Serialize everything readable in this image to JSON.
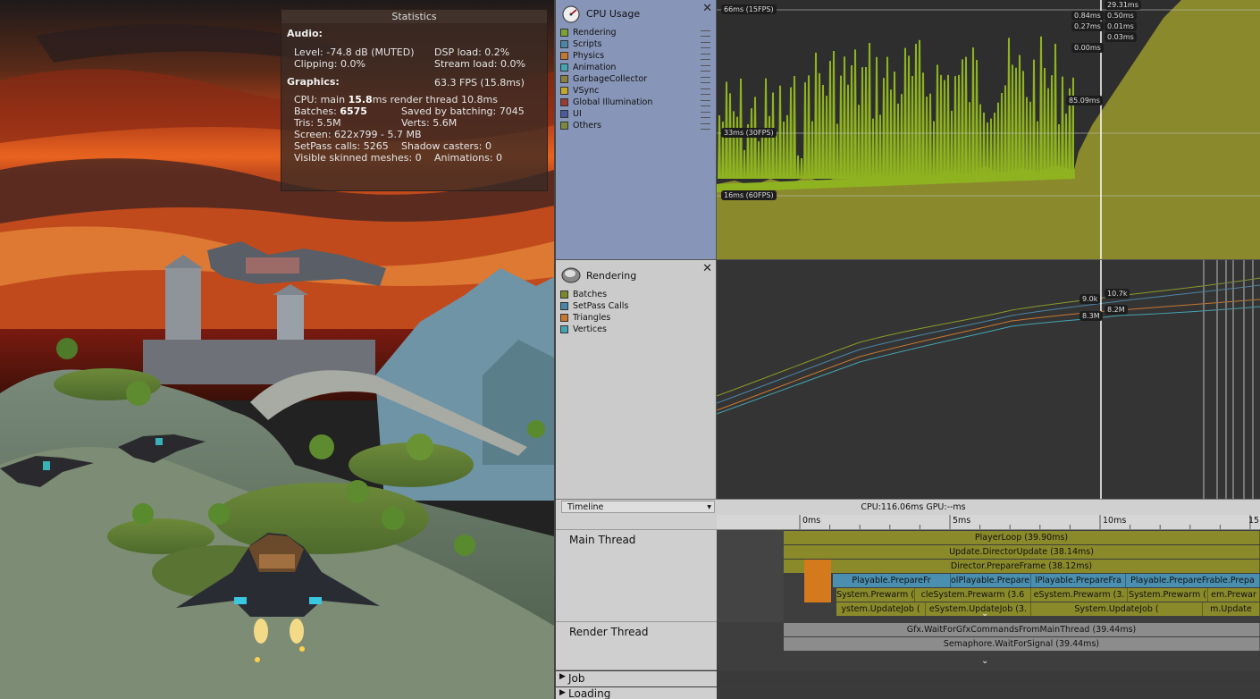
{
  "stats": {
    "title": "Statistics",
    "audio_header": "Audio:",
    "audio_level": "Level: -74.8 dB (MUTED)",
    "audio_dsp": "DSP load: 0.2%",
    "audio_clipping": "Clipping: 0.0%",
    "audio_stream": "Stream load: 0.0%",
    "graphics_header": "Graphics:",
    "fps": "63.3 FPS (15.8ms)",
    "cpu_prefix": "CPU: main ",
    "cpu_main": "15.8",
    "cpu_suffix": "ms  render thread 10.8ms",
    "batches_prefix": "Batches: ",
    "batches": "6575",
    "saved_batching": "Saved by batching: 7045",
    "tris": "Tris: 5.5M",
    "verts": "Verts: 5.6M",
    "screen": "Screen: 622x799 - 5.7 MB",
    "setpass": "SetPass calls: 5265",
    "shadow": "Shadow casters: 0",
    "skinned": "Visible skinned meshes: 0",
    "animations": "Animations: 0"
  },
  "cpu_module": {
    "title": "CPU Usage",
    "close": "✕",
    "legend": [
      {
        "label": "Rendering",
        "color": "#7da330"
      },
      {
        "label": "Scripts",
        "color": "#4a86a6"
      },
      {
        "label": "Physics",
        "color": "#c8782e"
      },
      {
        "label": "Animation",
        "color": "#44a5b2"
      },
      {
        "label": "GarbageCollector",
        "color": "#8a8040"
      },
      {
        "label": "VSync",
        "color": "#c4a82c"
      },
      {
        "label": "Global Illumination",
        "color": "#9a3a30"
      },
      {
        "label": "UI",
        "color": "#4a5a9a"
      },
      {
        "label": "Others",
        "color": "#7a8a3a"
      }
    ],
    "guides": [
      "66ms (15FPS)",
      "33ms (30FPS)",
      "16ms (60FPS)"
    ],
    "tags_left": [
      "0.84ms",
      "0.27ms",
      "0.00ms",
      "85.09ms"
    ],
    "tags_right": [
      "29.31ms",
      "0.50ms",
      "0.01ms",
      "0.03ms"
    ]
  },
  "rendering_module": {
    "title": "Rendering",
    "close": "✕",
    "legend": [
      {
        "label": "Batches",
        "color": "#7a8a2a"
      },
      {
        "label": "SetPass Calls",
        "color": "#4a86a6"
      },
      {
        "label": "Triangles",
        "color": "#c8782e"
      },
      {
        "label": "Vertices",
        "color": "#44a5b2"
      }
    ],
    "tags": [
      "9.0k",
      "10.7k",
      "8.2M",
      "8.3M"
    ]
  },
  "timeline": {
    "view_mode": "Timeline",
    "cpu_gpu": "CPU:116.06ms   GPU:--ms",
    "ticks": [
      "0ms",
      "5ms",
      "10ms",
      "15ms"
    ],
    "main_thread": "Main Thread",
    "render_thread": "Render Thread",
    "job": "Job",
    "loading": "Loading",
    "main_bars": [
      "PlayerLoop (39.90ms)",
      "Update.DirectorUpdate (38.14ms)",
      "Director.PrepareFrame (38.12ms)"
    ],
    "prepare_frames": [
      "Playable.PrepareFr",
      "olPlayable.PrepareFram",
      "lPlayable.PrepareFra",
      "Playable.PrepareFrable.Prepa"
    ],
    "prewarm": [
      "System.Prewarm (",
      "cleSystem.Prewarm (3.6",
      "eSystem.Prewarm (3.",
      "System.Prewarm (",
      "em.Prewar"
    ],
    "update_jobs": [
      "ystem.UpdateJob (",
      "eSystem.UpdateJob (3.",
      "System.UpdateJob (",
      "m.Update"
    ],
    "render_bars": [
      "Gfx.WaitForGfxCommandsFromMainThread (39.44ms)",
      "Semaphore.WaitForSignal (39.44ms)"
    ]
  }
}
